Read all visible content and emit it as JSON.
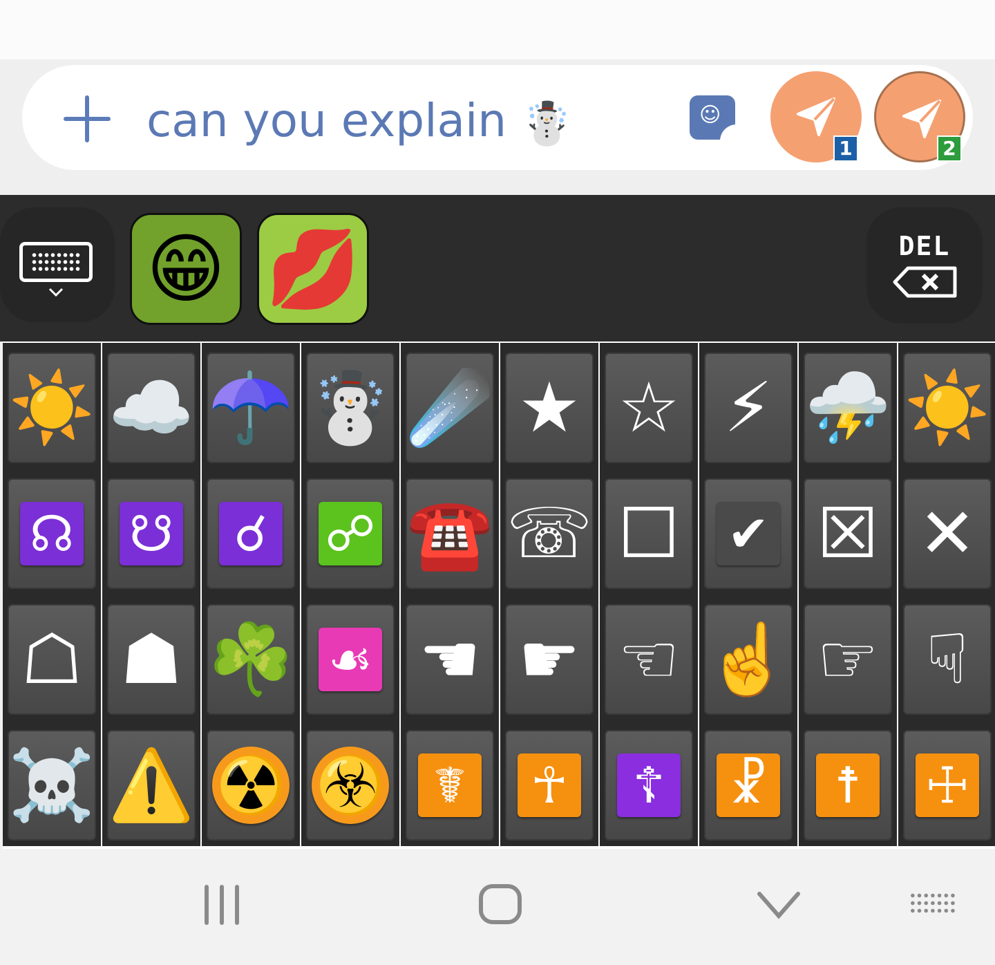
{
  "composer": {
    "message_text": "can you explain",
    "message_emoji": "☃️",
    "send_buttons": [
      {
        "badge": "1",
        "badge_color": "#1d5fa7"
      },
      {
        "badge": "2",
        "badge_color": "#2d9c3c"
      }
    ]
  },
  "emoji_bar": {
    "recent": [
      "😁",
      "💋"
    ],
    "delete_label": "DEL"
  },
  "emoji_grid": [
    [
      {
        "name": "sun-icon",
        "glyph": "☀️"
      },
      {
        "name": "cloud-icon",
        "glyph": "☁️"
      },
      {
        "name": "umbrella-icon",
        "glyph": "☂️"
      },
      {
        "name": "snowman-icon",
        "glyph": "☃️"
      },
      {
        "name": "comet-icon",
        "glyph": "☄️"
      },
      {
        "name": "black-star-icon",
        "glyph": "★"
      },
      {
        "name": "white-star-icon",
        "glyph": "☆"
      },
      {
        "name": "lightning-icon",
        "glyph": "⚡"
      },
      {
        "name": "thunder-cloud-icon",
        "glyph": "⛈️"
      },
      {
        "name": "sun-icon",
        "glyph": "☀️"
      }
    ],
    [
      {
        "name": "ascending-node-icon",
        "glyph": "☊",
        "tile": "#7b2fd6"
      },
      {
        "name": "descending-node-icon",
        "glyph": "☋",
        "tile": "#7b2fd6"
      },
      {
        "name": "conjunction-icon",
        "glyph": "☌",
        "tile": "#7b2fd6"
      },
      {
        "name": "opposition-icon",
        "glyph": "☍",
        "tile": "#5cc21e"
      },
      {
        "name": "red-telephone-icon",
        "glyph": "☎️"
      },
      {
        "name": "white-telephone-icon",
        "glyph": "☏"
      },
      {
        "name": "ballot-box-icon",
        "glyph": "☐"
      },
      {
        "name": "check-box-icon",
        "glyph": "✔",
        "tile": "#4a4a4a"
      },
      {
        "name": "ballot-box-x-icon",
        "glyph": "☒"
      },
      {
        "name": "saltire-icon",
        "glyph": "✕"
      }
    ],
    [
      {
        "name": "white-shogi-piece-icon",
        "glyph": "☖"
      },
      {
        "name": "black-shogi-piece-icon",
        "glyph": "☗"
      },
      {
        "name": "shamrock-icon",
        "glyph": "☘️"
      },
      {
        "name": "floral-heart-icon",
        "glyph": "☙",
        "tile": "#e83ab5"
      },
      {
        "name": "black-left-pointing-index-icon",
        "glyph": "☚"
      },
      {
        "name": "black-right-pointing-index-icon",
        "glyph": "☛"
      },
      {
        "name": "white-left-pointing-index-icon",
        "glyph": "☜"
      },
      {
        "name": "index-pointing-up-icon",
        "glyph": "☝️"
      },
      {
        "name": "white-right-pointing-index-icon",
        "glyph": "☞"
      },
      {
        "name": "white-down-pointing-index-icon",
        "glyph": "☟"
      }
    ],
    [
      {
        "name": "skull-crossbones-icon",
        "glyph": "☠️"
      },
      {
        "name": "warning-icon",
        "glyph": "⚠️"
      },
      {
        "name": "radioactive-icon",
        "glyph": "☢️",
        "circle": "#f79a1c"
      },
      {
        "name": "biohazard-icon",
        "glyph": "☣️",
        "circle": "#f79a1c"
      },
      {
        "name": "caduceus-icon",
        "glyph": "☤",
        "tile": "#f6900f"
      },
      {
        "name": "ankh-icon",
        "glyph": "☥",
        "tile": "#f6900f"
      },
      {
        "name": "orthodox-cross-icon",
        "glyph": "☦",
        "tile": "#8a2ee0"
      },
      {
        "name": "chi-rho-icon",
        "glyph": "☧",
        "tile": "#f6900f"
      },
      {
        "name": "cross-of-lorraine-icon",
        "glyph": "☨",
        "tile": "#f6900f"
      },
      {
        "name": "cross-of-jerusalem-icon",
        "glyph": "☩",
        "tile": "#f6900f"
      }
    ]
  ]
}
